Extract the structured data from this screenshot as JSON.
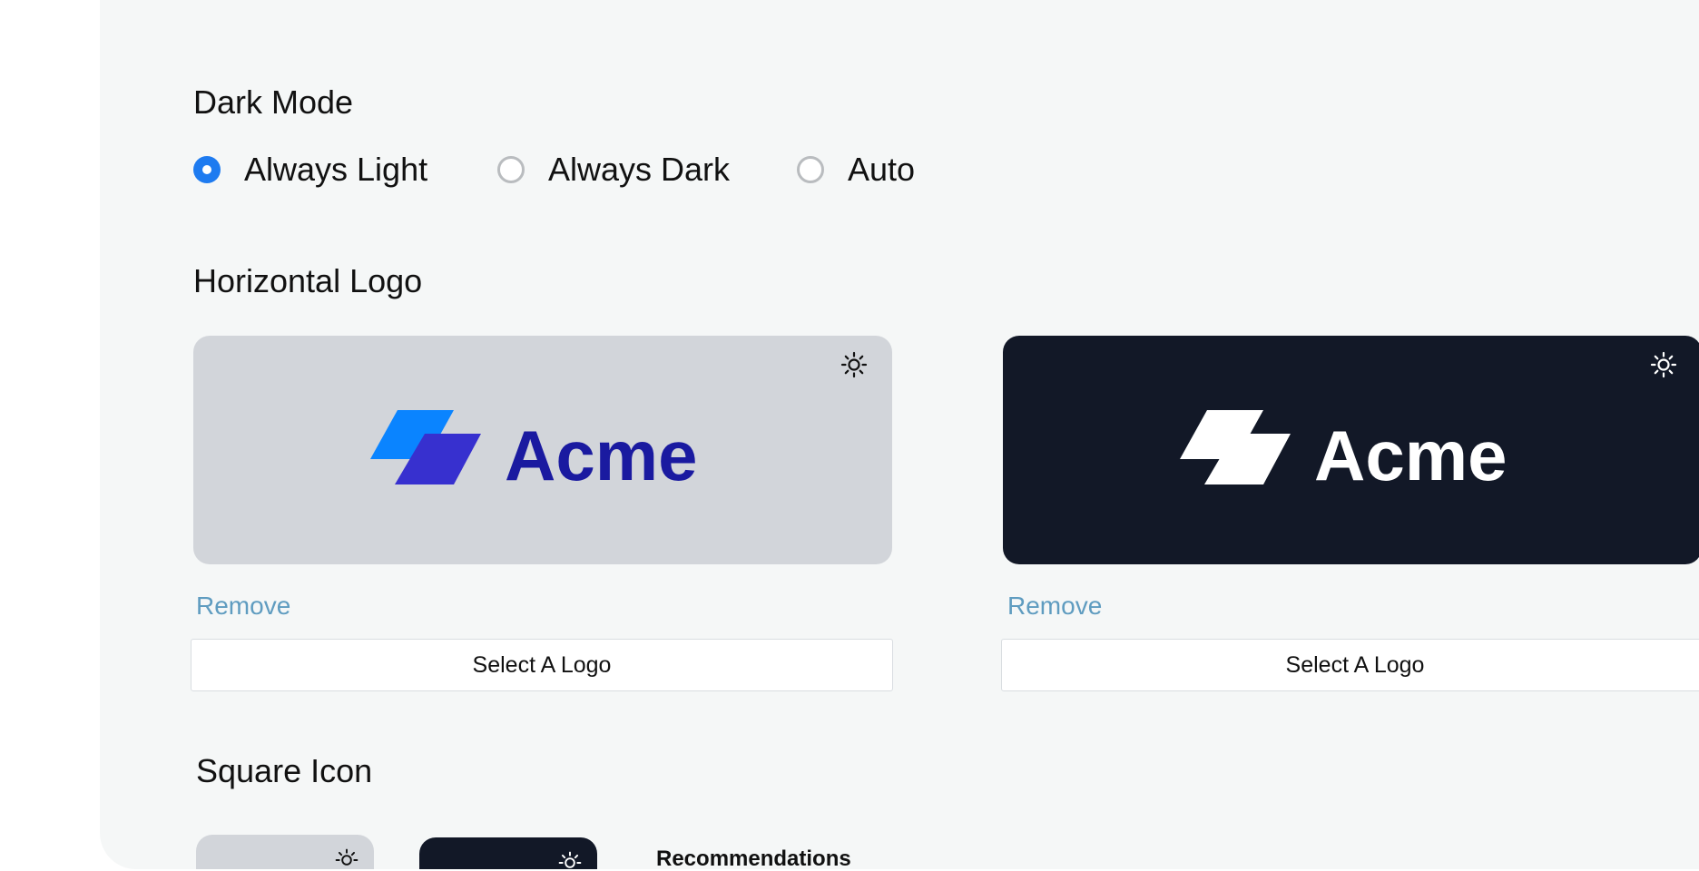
{
  "dark_mode": {
    "title": "Dark Mode",
    "options": [
      {
        "label": "Always Light",
        "checked": true
      },
      {
        "label": "Always Dark",
        "checked": false
      },
      {
        "label": "Auto",
        "checked": false
      }
    ]
  },
  "horizontal_logo": {
    "title": "Horizontal Logo",
    "light": {
      "brand_text": "Acme",
      "background": "#d2d5da",
      "brand_color": "#1a1aa0",
      "mark_top_color": "#0a84ff",
      "mark_bottom_color": "#3730cf",
      "toggle_icon": "sun-icon",
      "remove_label": "Remove",
      "select_label": "Select A Logo"
    },
    "dark": {
      "brand_text": "Acme",
      "background": "#121827",
      "brand_color": "#ffffff",
      "toggle_icon": "sun-icon",
      "remove_label": "Remove",
      "select_label": "Select A Logo"
    }
  },
  "square_icon": {
    "title": "Square Icon",
    "recommendations_label": "Recommendations"
  },
  "colors": {
    "accent": "#1e7bf0",
    "link": "#5f9cc0",
    "panel": "#f5f7f7"
  }
}
